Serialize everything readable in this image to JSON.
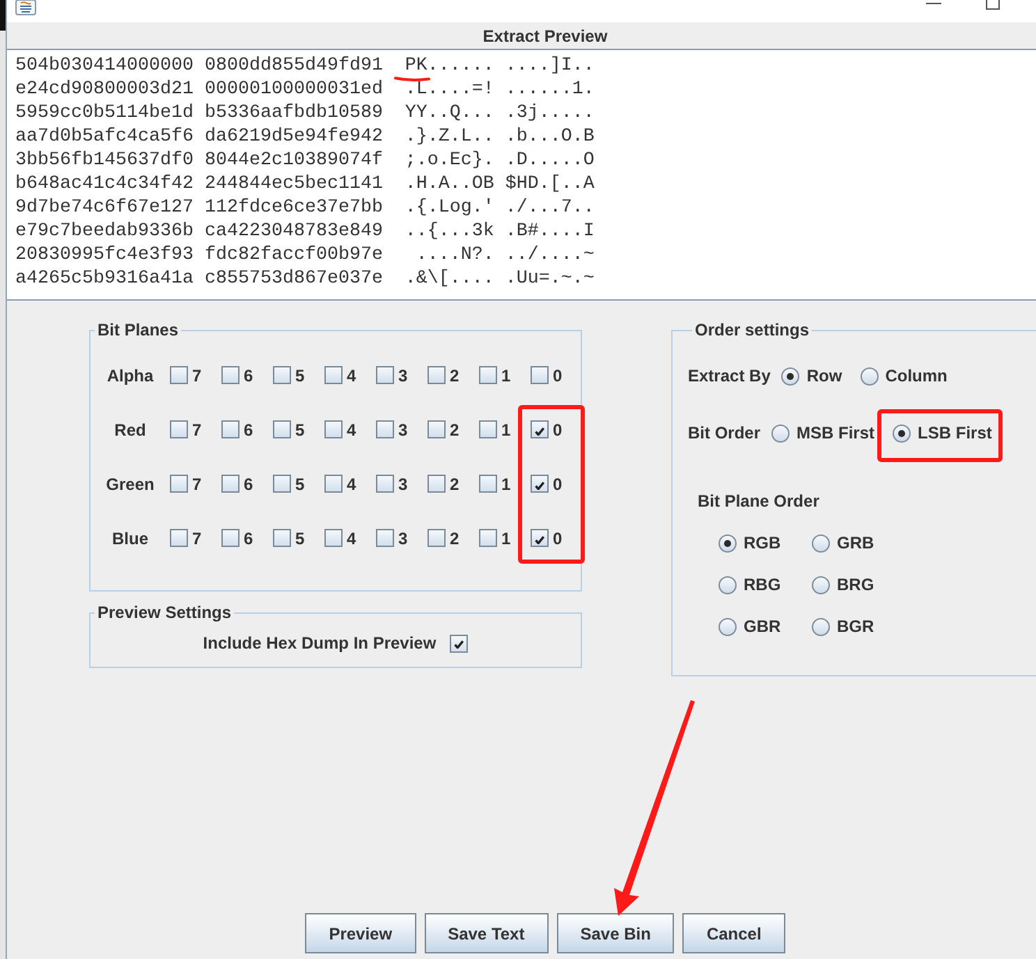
{
  "preview": {
    "title": "Extract Preview",
    "lines": [
      "504b030414000000 0800dd855d49fd91  PK...... ....]I..",
      "e24cd90800003d21 00000100000031ed  .L....=! ......1.",
      "5959cc0b5114be1d b5336aafbdb10589  YY..Q... .3j.....",
      "aa7d0b5afc4ca5f6 da6219d5e94fe942  .}.Z.L.. .b...O.B",
      "3bb56fb145637df0 8044e2c10389074f  ;.o.Ec}. .D.....O",
      "b648ac41c4c34f42 244844ec5bec1141  .H.A..OB $HD.[..A",
      "9d7be74c6f67e127 112fdce6ce37e7bb  .{.Log.' ./...7..",
      "e79c7beedab9336b ca4223048783e849  ..{...3k .B#....I",
      "20830995fc4e3f93 fdc82faccf00b97e   ....N?. ../....~",
      "a4265c5b9316a41a c855753d867e037e  .&\\[.... .Uu=.~.~"
    ]
  },
  "bit_planes": {
    "title": "Bit Planes",
    "channels": [
      {
        "name": "Alpha",
        "bits": [
          {
            "label": "7",
            "checked": false
          },
          {
            "label": "6",
            "checked": false
          },
          {
            "label": "5",
            "checked": false
          },
          {
            "label": "4",
            "checked": false
          },
          {
            "label": "3",
            "checked": false
          },
          {
            "label": "2",
            "checked": false
          },
          {
            "label": "1",
            "checked": false
          },
          {
            "label": "0",
            "checked": false
          }
        ]
      },
      {
        "name": "Red",
        "bits": [
          {
            "label": "7",
            "checked": false
          },
          {
            "label": "6",
            "checked": false
          },
          {
            "label": "5",
            "checked": false
          },
          {
            "label": "4",
            "checked": false
          },
          {
            "label": "3",
            "checked": false
          },
          {
            "label": "2",
            "checked": false
          },
          {
            "label": "1",
            "checked": false
          },
          {
            "label": "0",
            "checked": true
          }
        ]
      },
      {
        "name": "Green",
        "bits": [
          {
            "label": "7",
            "checked": false
          },
          {
            "label": "6",
            "checked": false
          },
          {
            "label": "5",
            "checked": false
          },
          {
            "label": "4",
            "checked": false
          },
          {
            "label": "3",
            "checked": false
          },
          {
            "label": "2",
            "checked": false
          },
          {
            "label": "1",
            "checked": false
          },
          {
            "label": "0",
            "checked": true
          }
        ]
      },
      {
        "name": "Blue",
        "bits": [
          {
            "label": "7",
            "checked": false
          },
          {
            "label": "6",
            "checked": false
          },
          {
            "label": "5",
            "checked": false
          },
          {
            "label": "4",
            "checked": false
          },
          {
            "label": "3",
            "checked": false
          },
          {
            "label": "2",
            "checked": false
          },
          {
            "label": "1",
            "checked": false
          },
          {
            "label": "0",
            "checked": true
          }
        ]
      }
    ]
  },
  "preview_settings": {
    "title": "Preview Settings",
    "options": [
      {
        "label": "Include Hex Dump In Preview",
        "checked": true
      }
    ]
  },
  "order_settings": {
    "title": "Order settings",
    "extract_by": {
      "label": "Extract By",
      "options": [
        {
          "label": "Row",
          "selected": true
        },
        {
          "label": "Column",
          "selected": false
        }
      ]
    },
    "bit_order": {
      "label": "Bit Order",
      "options": [
        {
          "label": "MSB First",
          "selected": false
        },
        {
          "label": "LSB First",
          "selected": true
        }
      ]
    },
    "bit_plane_order": {
      "label": "Bit Plane Order",
      "options": [
        {
          "label": "RGB",
          "selected": true
        },
        {
          "label": "GRB",
          "selected": false
        },
        {
          "label": "RBG",
          "selected": false
        },
        {
          "label": "BRG",
          "selected": false
        },
        {
          "label": "GBR",
          "selected": false
        },
        {
          "label": "BGR",
          "selected": false
        }
      ]
    }
  },
  "buttons": [
    {
      "label": "Preview"
    },
    {
      "label": "Save Text"
    },
    {
      "label": "Save Bin"
    },
    {
      "label": "Cancel"
    }
  ],
  "annotations": [
    {
      "kind": "underline"
    },
    {
      "kind": "frame"
    },
    {
      "kind": "frame"
    },
    {
      "kind": "arrow"
    }
  ]
}
